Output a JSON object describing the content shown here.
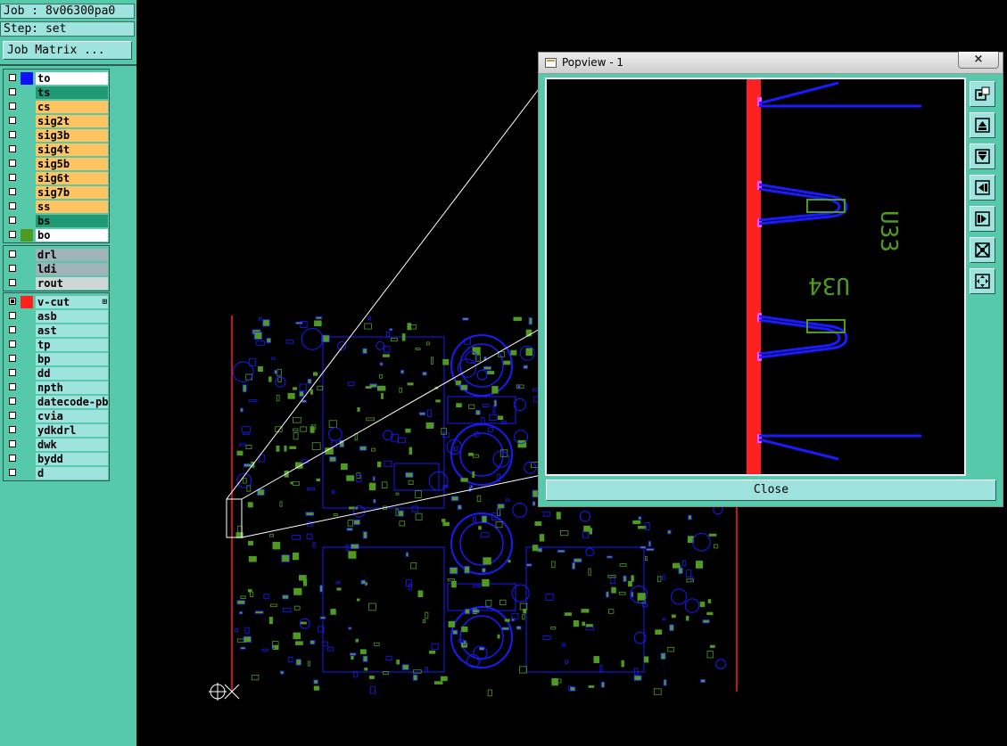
{
  "job_label": "Job : 8v06300pa0",
  "step_label": "Step: set",
  "job_matrix_button": "Job Matrix ...",
  "layer_groups": [
    {
      "layers": [
        {
          "name": "to",
          "swatch": "#1010ff",
          "name_bg": "#ffffff",
          "checked": false
        },
        {
          "name": "ts",
          "swatch": "",
          "name_bg": "#1f9a74",
          "checked": false
        },
        {
          "name": "cs",
          "swatch": "",
          "name_bg": "#ffc461",
          "checked": false
        },
        {
          "name": "sig2t",
          "swatch": "",
          "name_bg": "#ffc461",
          "checked": false
        },
        {
          "name": "sig3b",
          "swatch": "",
          "name_bg": "#ffc461",
          "checked": false
        },
        {
          "name": "sig4t",
          "swatch": "",
          "name_bg": "#ffc461",
          "checked": false
        },
        {
          "name": "sig5b",
          "swatch": "",
          "name_bg": "#ffc461",
          "checked": false
        },
        {
          "name": "sig6t",
          "swatch": "",
          "name_bg": "#ffc461",
          "checked": false
        },
        {
          "name": "sig7b",
          "swatch": "",
          "name_bg": "#ffc461",
          "checked": false
        },
        {
          "name": "ss",
          "swatch": "",
          "name_bg": "#ffc461",
          "checked": false
        },
        {
          "name": "bs",
          "swatch": "",
          "name_bg": "#1f9a74",
          "checked": false
        },
        {
          "name": "bo",
          "swatch": "#4f9b22",
          "name_bg": "#ffffff",
          "checked": false
        }
      ]
    },
    {
      "layers": [
        {
          "name": "drl",
          "swatch": "",
          "name_bg": "#9fb3b8",
          "checked": false
        },
        {
          "name": "ldi",
          "swatch": "",
          "name_bg": "#9fb3b8",
          "checked": false
        },
        {
          "name": "rout",
          "swatch": "",
          "name_bg": "#cfd6d6",
          "checked": false
        }
      ]
    },
    {
      "layers": [
        {
          "name": "v-cut",
          "swatch": "#ff2020",
          "name_bg": "#9ee3dd",
          "checked": true,
          "mark": true
        },
        {
          "name": "asb",
          "swatch": "",
          "name_bg": "#9ee3dd",
          "checked": false
        },
        {
          "name": "ast",
          "swatch": "",
          "name_bg": "#9ee3dd",
          "checked": false
        },
        {
          "name": "tp",
          "swatch": "",
          "name_bg": "#9ee3dd",
          "checked": false
        },
        {
          "name": "bp",
          "swatch": "",
          "name_bg": "#9ee3dd",
          "checked": false
        },
        {
          "name": "dd",
          "swatch": "",
          "name_bg": "#9ee3dd",
          "checked": false
        },
        {
          "name": "npth",
          "swatch": "",
          "name_bg": "#9ee3dd",
          "checked": false
        },
        {
          "name": "datecode-pbo",
          "swatch": "",
          "name_bg": "#9ee3dd",
          "checked": false
        },
        {
          "name": "cvia",
          "swatch": "",
          "name_bg": "#9ee3dd",
          "checked": false
        },
        {
          "name": "ydkdrl",
          "swatch": "",
          "name_bg": "#9ee3dd",
          "checked": false
        },
        {
          "name": "dwk",
          "swatch": "",
          "name_bg": "#9ee3dd",
          "checked": false
        },
        {
          "name": "bydd",
          "swatch": "",
          "name_bg": "#9ee3dd",
          "checked": false
        },
        {
          "name": "d",
          "swatch": "",
          "name_bg": "#9ee3dd",
          "checked": false
        }
      ]
    }
  ],
  "popview": {
    "title": "Popview - 1",
    "close_x": "×",
    "close_button": "Close",
    "silk_label_main": "U34",
    "silk_label_side": "U33",
    "tool_icons": [
      "zoom-home-icon",
      "pan-up-icon",
      "pan-down-icon",
      "pan-left-icon",
      "pan-right-icon",
      "zoom-out-icon",
      "fit-view-icon"
    ]
  },
  "colors": {
    "panel_bg": "#56c9ab",
    "canvas_bg": "#000000",
    "top_layer_blue": "#1010ff",
    "silk_green": "#4f9b22",
    "vcut_red": "#ff2020"
  }
}
